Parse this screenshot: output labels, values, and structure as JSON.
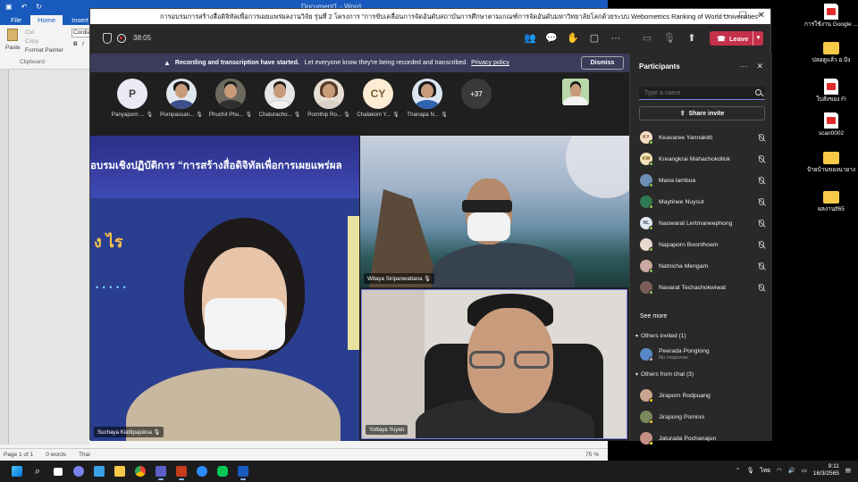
{
  "word": {
    "title_doc": "Document1 - Word",
    "tabs": [
      "File",
      "Home",
      "Insert"
    ],
    "active_tab": "Home",
    "ribbon": {
      "cut": "Cut",
      "copy": "Copy",
      "paste": "Paste",
      "format_painter": "Format Painter",
      "clipboard": "Clipboard",
      "font": "Cordia",
      "bold": "B",
      "italic": "I"
    },
    "status": {
      "page": "Page 1 of 1",
      "words": "0 words",
      "lang": "Thai",
      "zoom": "75 %"
    }
  },
  "desktop_icons": [
    {
      "label": "การใช้งาน Google ...",
      "type": "pdf"
    },
    {
      "label": "ปลอดูแล้ว อ.ปัง",
      "type": "folder"
    },
    {
      "label": "ใบสั่งของ Fl",
      "type": "pdf"
    },
    {
      "label": "scan0002",
      "type": "pdf"
    },
    {
      "label": "ป้ายบ้านของนายาง",
      "type": "folder"
    },
    {
      "label": "ผลงานff65",
      "type": "folder"
    }
  ],
  "meeting": {
    "title": "การอบรมการสร้างสื่อดิจิทัลเพื่อการเผยแพร่ผลงานวิจัย รุ่นที่ 2 โครงการ \"การขับเคลื่อนการจัดอันดับสถาบันการศึกษาตามเกณฑ์การจัดอันดับมหาวิทยาลัยโลกด้วยระบบ Webometrics Ranking of World Universities\"",
    "timer": "38:05",
    "leave_label": "Leave",
    "banner": {
      "bold": "Recording and transcription have started.",
      "text": "Let everyone know they're being recorded and transcribed.",
      "link": "Privacy policy",
      "dismiss": "Dismiss"
    },
    "gallery": [
      {
        "name": "Panyaporn ...",
        "initial": "P",
        "bg": "#e9eaf6",
        "photo": false
      },
      {
        "name": "Pornpassan...",
        "initial": "",
        "bg": "#dfe7ef",
        "photo": true,
        "body": "#3c4f8a"
      },
      {
        "name": "Phuchit Phu...",
        "initial": "",
        "bg": "#6c6a5e",
        "photo": true,
        "body": "#2f2f2f"
      },
      {
        "name": "Chaturacho...",
        "initial": "",
        "bg": "#e6e6e6",
        "photo": true,
        "body": "#f1f1f1"
      },
      {
        "name": "Pornthip Ro...",
        "initial": "",
        "bg": "#e8dfd3",
        "photo": true,
        "body": "#d8d2c9"
      },
      {
        "name": "Chalakom Y...",
        "initial": "CY",
        "bg": "#fbecd3",
        "photo": false
      },
      {
        "name": "Thanapa N...",
        "initial": "",
        "bg": "#dce6f2",
        "photo": true,
        "body": "#2e63b0"
      }
    ],
    "more_count": "+37",
    "videos": {
      "main_name": "Suchaya Kiattipajuksa",
      "slide_title": "อบรมเชิงปฏิบัติการ “การสร้างสื่อดิจิทัลเพื่อการเผยแพร่ผล",
      "slide_deco": "ง ไร",
      "top_right_name": "Witaya Siripanwattana",
      "bottom_right_name": "Yuttaya Yuyen"
    }
  },
  "participants": {
    "title": "Participants",
    "search_placeholder": "Type a name",
    "share_label": "Share invite",
    "in_meeting": [
      {
        "name": "Keavaree Yannakitti",
        "initials": "KY",
        "bg": "#f5dcc4"
      },
      {
        "name": "Kreangkrai Mahachokdilok",
        "initials": "KM",
        "bg": "#f4e2b8"
      },
      {
        "name": "Mana lambua",
        "initials": "",
        "bg": "#6d8fb5"
      },
      {
        "name": "Maytinee Nuysut",
        "initials": "",
        "bg": "#2f7a52"
      },
      {
        "name": "Naowarat Lertmaneephong",
        "initials": "NL",
        "bg": "#dfe6ee"
      },
      {
        "name": "Napaporn Boonthoem",
        "initials": "",
        "bg": "#e9d9ce"
      },
      {
        "name": "Natnicha Mengam",
        "initials": "",
        "bg": "#c9a9a0"
      },
      {
        "name": "Navarat Techachokwiwat",
        "initials": "",
        "bg": "#7a5d56"
      }
    ],
    "see_more": "See more",
    "invited_header": "Others invited (1)",
    "invited": [
      {
        "name": "Peerada Pongtong",
        "status": "No response",
        "bg": "#5a87c6"
      }
    ],
    "chat_header": "Others from chat (3)",
    "from_chat": [
      {
        "name": "Jiraporn Rodpuang",
        "bg": "#c8a692"
      },
      {
        "name": "Jirapong Pomnoi",
        "bg": "#7a8a5e"
      },
      {
        "name": "Jaturada Pochanajun",
        "bg": "#c58f86"
      }
    ]
  },
  "taskbar": {
    "lang": "ไทย",
    "time": "9:11",
    "date": "16/3/2565"
  }
}
